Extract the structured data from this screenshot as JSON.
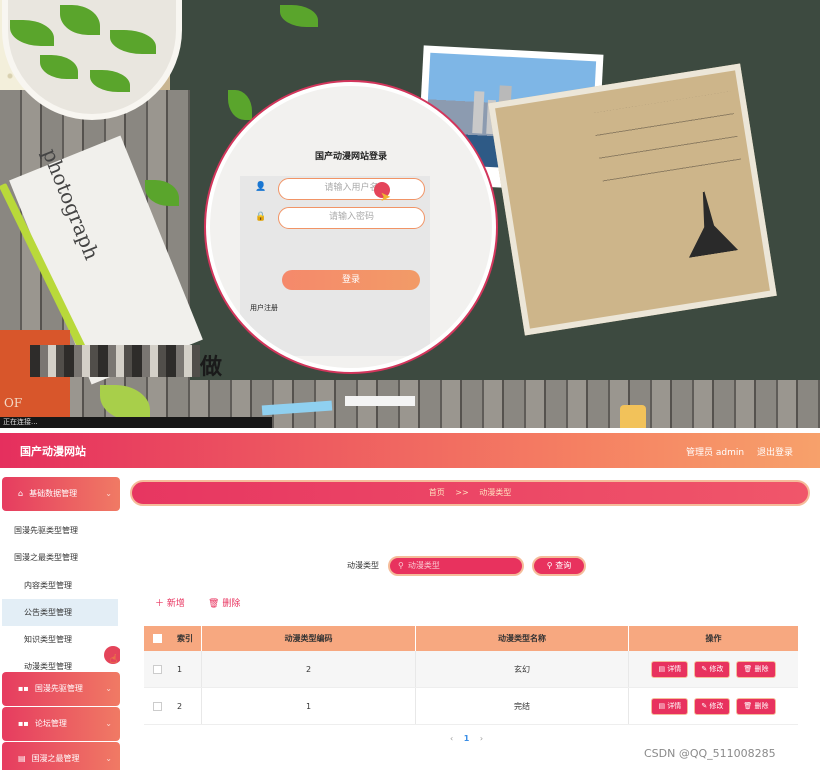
{
  "login": {
    "title": "国产动漫网站登录",
    "username_placeholder": "请输入用户名",
    "password_placeholder": "请输入密码",
    "login_button": "登录",
    "register_link": "用户注册",
    "photocard_text": "photograph",
    "book_text": "OF",
    "pixel_char": "做",
    "status_text": "正在连接..."
  },
  "header": {
    "site_title": "国产动漫网站",
    "admin_user": "管理员 admin",
    "logout": "退出登录"
  },
  "sidebar": {
    "groups": [
      {
        "label": "基础数据管理",
        "icon": "home-icon"
      },
      {
        "label": "国漫先驱管理",
        "icon": "grid-icon"
      },
      {
        "label": "论坛管理",
        "icon": "grid-icon"
      },
      {
        "label": "国漫之最管理",
        "icon": "book-icon"
      }
    ],
    "items": [
      {
        "label": "国漫先驱类型管理"
      },
      {
        "label": "国漫之最类型管理"
      },
      {
        "label": "内容类型管理"
      },
      {
        "label": "公告类型管理"
      },
      {
        "label": "知识类型管理"
      },
      {
        "label": "动漫类型管理"
      }
    ]
  },
  "breadcrumb": {
    "home": "首页",
    "sep": ">>",
    "current": "动漫类型"
  },
  "search": {
    "label": "动漫类型",
    "placeholder": "动漫类型",
    "button": "查询"
  },
  "toolbar": {
    "add": "新增",
    "delete": "删除"
  },
  "table": {
    "headers": [
      "索引",
      "动漫类型编码",
      "动漫类型名称",
      "操作"
    ],
    "rows": [
      {
        "index": "1",
        "code": "2",
        "name": "玄幻"
      },
      {
        "index": "2",
        "code": "1",
        "name": "完结"
      }
    ],
    "actions": {
      "detail": "详情",
      "edit": "修改",
      "delete": "删除"
    }
  },
  "pagination": {
    "prev": "‹",
    "current": "1",
    "next": "›"
  },
  "watermark": "CSDN @QQ_511008285",
  "colors": {
    "accent": "#e8325e",
    "accent_light": "#f7a880"
  }
}
